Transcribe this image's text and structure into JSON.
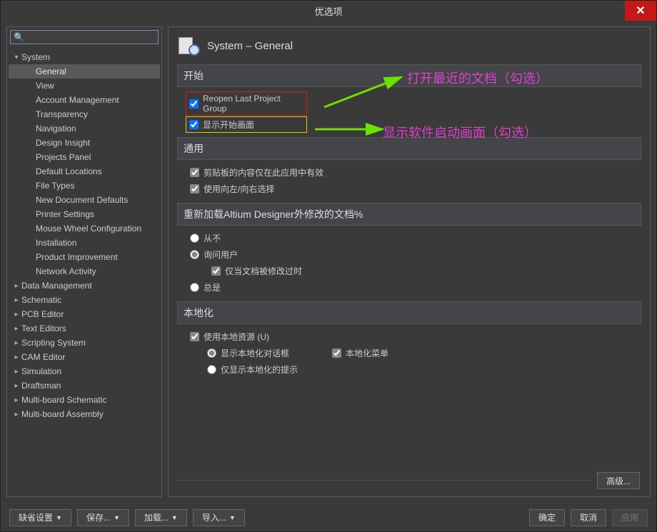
{
  "window": {
    "title": "优选项"
  },
  "search": {
    "placeholder": ""
  },
  "tree": {
    "top": "System",
    "systemChildren": [
      "General",
      "View",
      "Account Management",
      "Transparency",
      "Navigation",
      "Design Insight",
      "Projects Panel",
      "Default Locations",
      "File Types",
      "New Document Defaults",
      "Printer Settings",
      "Mouse Wheel Configuration",
      "Installation",
      "Product Improvement",
      "Network Activity"
    ],
    "other": [
      "Data Management",
      "Schematic",
      "PCB Editor",
      "Text Editors",
      "Scripting System",
      "CAM Editor",
      "Simulation",
      "Draftsman",
      "Multi-board Schematic",
      "Multi-board Assembly"
    ]
  },
  "page": {
    "headerTitle": "System – General",
    "sections": {
      "start": {
        "title": "开始",
        "reopenLast": "Reopen Last Project Group",
        "showStart": "显示开始画面"
      },
      "general": {
        "title": "通用",
        "clipboard": "剪贴板的内容仅在此应用中有效",
        "leftRight": "使用向左/向右选择"
      },
      "reload": {
        "title": "重新加载Altium Designer外修改的文档%",
        "never": "从不",
        "ask": "询问用户",
        "onlyModified": "仅当文档被修改过时",
        "always": "总是"
      },
      "local": {
        "title": "本地化",
        "useLocal": "使用本地资源 (U)",
        "showDialog": "显示本地化对话框",
        "localMenu": "本地化菜单",
        "onlyHint": "仅显示本地化的提示"
      }
    },
    "advanced": "高级..."
  },
  "annotations": {
    "openRecent": "打开最近的文档（勾选）",
    "showSplash": "显示软件启动画面（勾选）"
  },
  "buttons": {
    "default": "缺省设置",
    "save": "保存...",
    "load": "加载...",
    "import": "导入...",
    "ok": "确定",
    "cancel": "取消",
    "apply": "应用"
  }
}
